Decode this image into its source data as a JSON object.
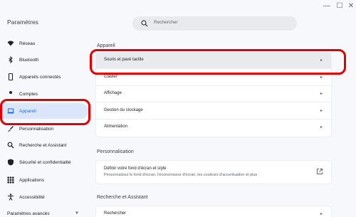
{
  "window": {
    "minimize_glyph": "—",
    "maximize_glyph": "☐",
    "close_glyph": "✕"
  },
  "header": {
    "title": "Paramètres",
    "search_placeholder": "Rechercher"
  },
  "sidebar": {
    "items": [
      {
        "label": "Réseau",
        "icon": "wifi-icon"
      },
      {
        "label": "Bluetooth",
        "icon": "bluetooth-icon"
      },
      {
        "label": "Appareils connectés",
        "icon": "phone-icon"
      },
      {
        "label": "Comptes",
        "icon": "person-icon"
      },
      {
        "label": "Appareil",
        "icon": "laptop-icon",
        "active": true
      },
      {
        "label": "Personnalisation",
        "icon": "brush-icon"
      },
      {
        "label": "Recherche et Assistant",
        "icon": "search-icon"
      },
      {
        "label": "Sécurité et confidentialité",
        "icon": "shield-icon"
      },
      {
        "label": "Applications",
        "icon": "apps-grid-icon"
      },
      {
        "label": "Accessibilité",
        "icon": "accessibility-icon"
      },
      {
        "label": "Paramètres avancés",
        "icon": "chevron-down-icon"
      }
    ]
  },
  "main": {
    "device_section": {
      "title": "Appareil",
      "rows": [
        {
          "label": "Souris et pavé tactile",
          "highlighted": true
        },
        {
          "label": "Clavier"
        },
        {
          "label": "Affichage"
        },
        {
          "label": "Gestion du stockage"
        },
        {
          "label": "Alimentation"
        }
      ]
    },
    "personalization_section": {
      "title": "Personnalisation",
      "row_title": "Définir votre fond d'écran et style",
      "row_desc": "Personnalisez le fond d'écran, l'économiseur d'écran, les couleurs d'accentuation et plus"
    },
    "search_section": {
      "title": "Recherche et Assistant",
      "row_label": "Rechercher"
    },
    "arrow_glyph": "▸"
  },
  "colors": {
    "accent": "#1a73e8",
    "annotation": "#e00000",
    "background": "#f7f8fc",
    "active_bg": "#dbe6fb"
  }
}
